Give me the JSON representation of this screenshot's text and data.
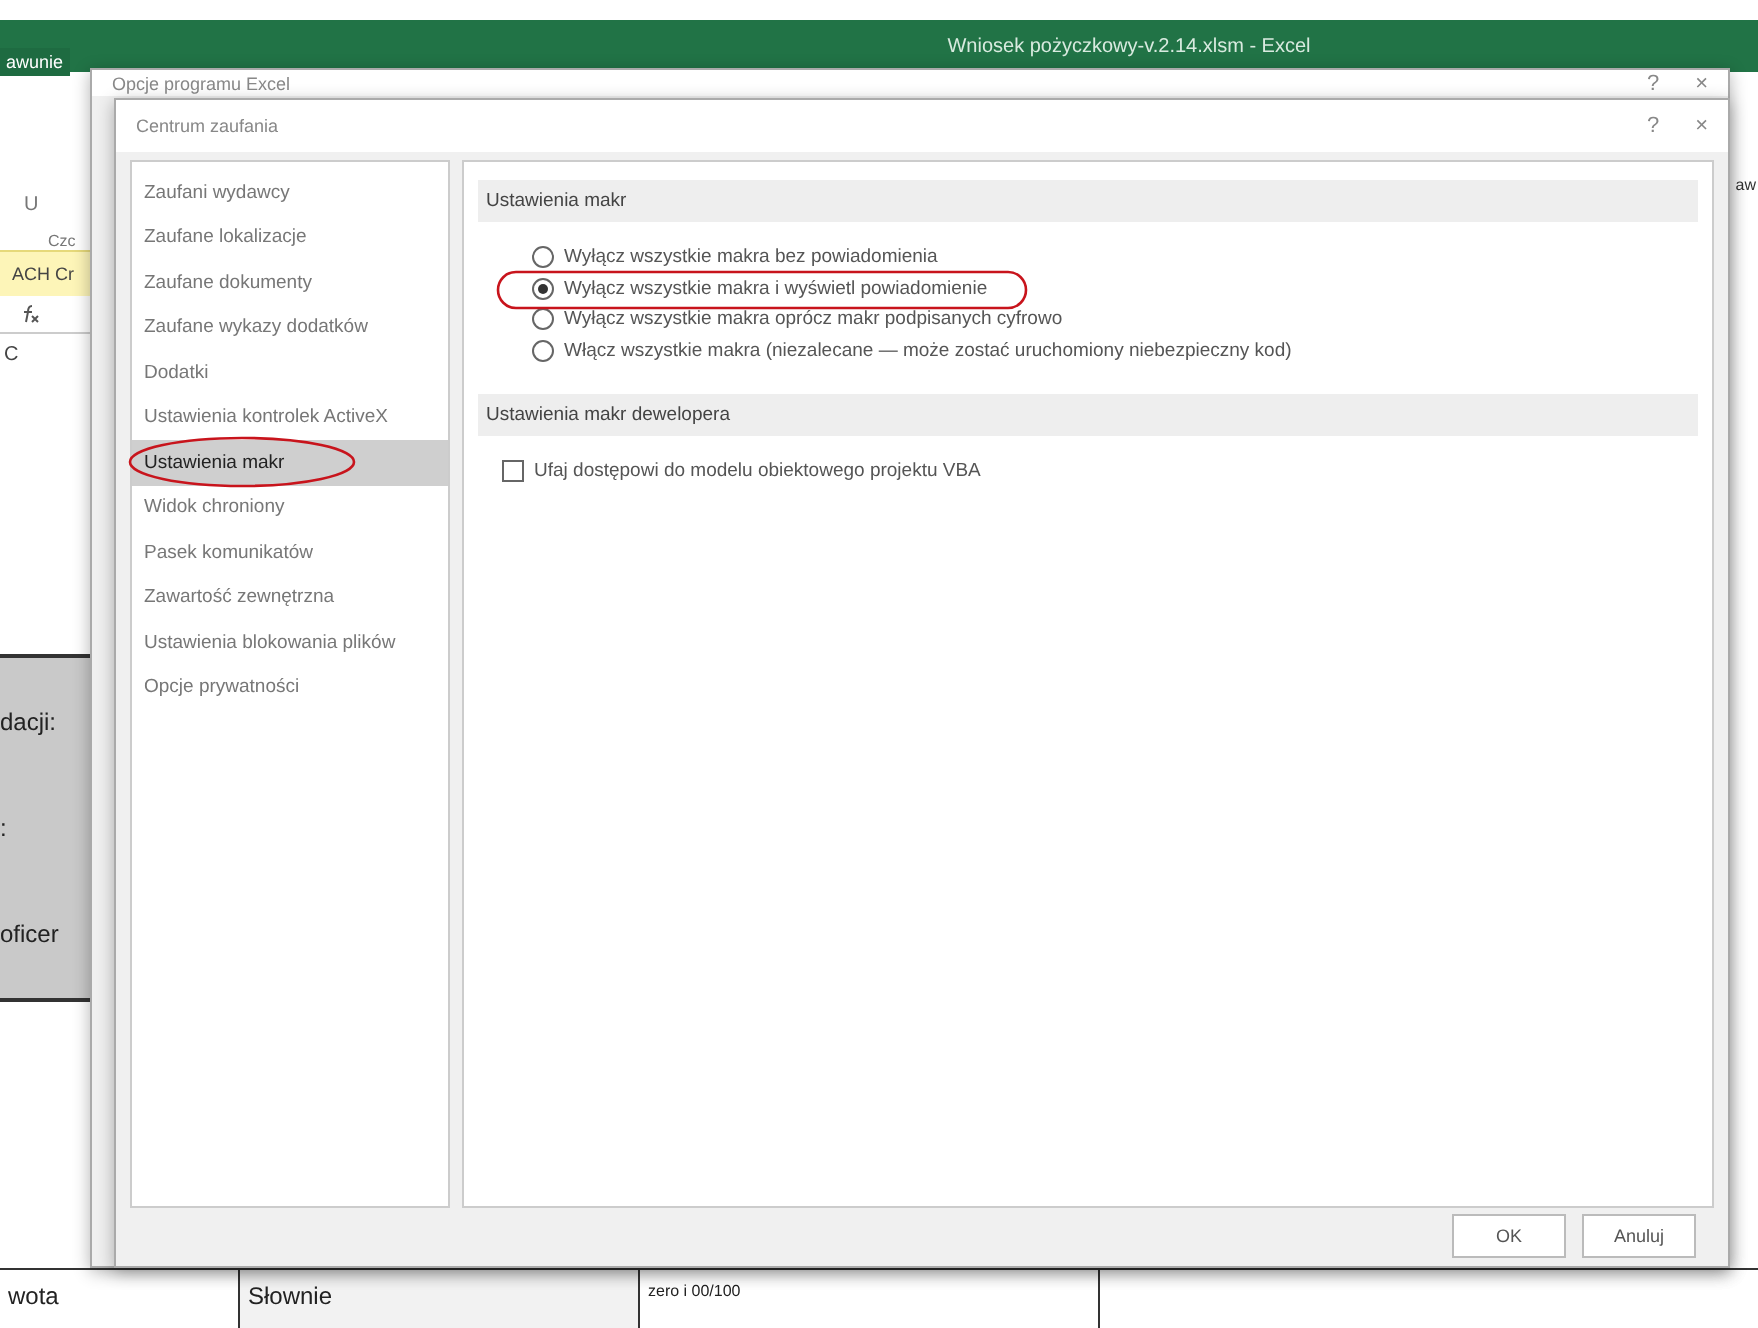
{
  "excel": {
    "title": "Wniosek pożyczkowy-v.2.14.xlsm - Excel",
    "ribbon_tab": "awunie",
    "ribbon_right": "aw",
    "underline_button": "U",
    "group_label": "Czc",
    "message_bar": "ACH Cr",
    "column_label": "C",
    "sheet_labels": [
      "dacji:",
      ":",
      "oficer"
    ],
    "bottom_row": [
      "wota",
      "Słownie",
      "zero i 00/100"
    ]
  },
  "back_dialog": {
    "title": "Opcje programu Excel",
    "help": "?",
    "close": "×"
  },
  "dialog": {
    "title": "Centrum zaufania",
    "help": "?",
    "close": "×",
    "nav": [
      {
        "label": "Zaufani wydawcy",
        "selected": false
      },
      {
        "label": "Zaufane lokalizacje",
        "selected": false
      },
      {
        "label": "Zaufane dokumenty",
        "selected": false
      },
      {
        "label": "Zaufane wykazy dodatków",
        "selected": false
      },
      {
        "label": "Dodatki",
        "selected": false
      },
      {
        "label": "Ustawienia kontrolek ActiveX",
        "selected": false
      },
      {
        "label": "Ustawienia makr",
        "selected": true
      },
      {
        "label": "Widok chroniony",
        "selected": false
      },
      {
        "label": "Pasek komunikatów",
        "selected": false
      },
      {
        "label": "Zawartość zewnętrzna",
        "selected": false
      },
      {
        "label": "Ustawienia blokowania plików",
        "selected": false
      },
      {
        "label": "Opcje prywatności",
        "selected": false
      }
    ],
    "sections": [
      {
        "heading": "Ustawienia makr",
        "options": [
          {
            "kind": "radio",
            "label": "Wyłącz wszystkie makra bez powiadomienia",
            "selected": false
          },
          {
            "kind": "radio",
            "label": "Wyłącz wszystkie makra i wyświetl powiadomienie",
            "selected": true
          },
          {
            "kind": "radio",
            "label": "Wyłącz wszystkie makra oprócz makr podpisanych cyfrowo",
            "selected": false
          },
          {
            "kind": "radio",
            "label": "Włącz wszystkie makra (niezalecane — może zostać uruchomiony niebezpieczny kod)",
            "selected": false
          }
        ]
      },
      {
        "heading": "Ustawienia makr dewelopera",
        "options": [
          {
            "kind": "checkbox",
            "label": "Ufaj dostępowi do modelu obiektowego projektu VBA",
            "checked": false
          }
        ]
      }
    ],
    "buttons": [
      "OK",
      "Anuluj"
    ]
  }
}
